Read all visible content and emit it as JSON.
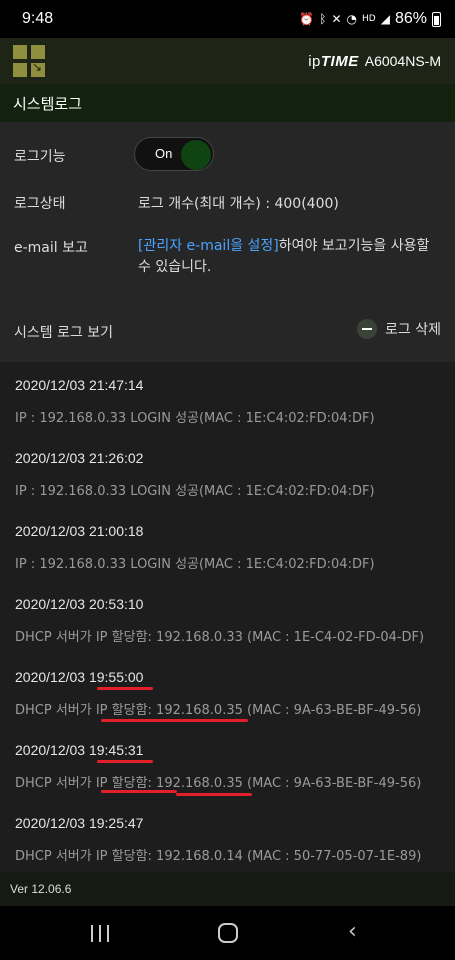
{
  "statusbar": {
    "time": "9:48",
    "battery": "86%"
  },
  "header": {
    "brand_prefix": "ip",
    "brand_name": "TIME",
    "model": "A6004NS-M"
  },
  "page": {
    "title": "시스템로그"
  },
  "settings": {
    "log_function_label": "로그기능",
    "toggle_label": "On",
    "toggle_on": true,
    "log_status_label": "로그상태",
    "log_status_value": "로그 개수(최대 개수) :  400(400)",
    "email_label": "e-mail 보고",
    "email_link": "[관리자 e-mail을 설정]",
    "email_text_after": "하여야 보고기능을 사용할 수 있습니다."
  },
  "log_section": {
    "title": "시스템 로그 보기",
    "delete_label": "로그 삭제"
  },
  "logs": [
    {
      "datetime": "2020/12/03 21:47:14",
      "message": "IP : 192.168.0.33 LOGIN 성공(MAC : 1E:C4:02:FD:04:DF)"
    },
    {
      "datetime": "2020/12/03 21:26:02",
      "message": "IP : 192.168.0.33 LOGIN 성공(MAC : 1E:C4:02:FD:04:DF)"
    },
    {
      "datetime": "2020/12/03 21:00:18",
      "message": "IP : 192.168.0.33 LOGIN 성공(MAC : 1E:C4:02:FD:04:DF)"
    },
    {
      "datetime": "2020/12/03 20:53:10",
      "message": "DHCP 서버가 IP 할당함: 192.168.0.33 (MAC : 1E-C4-02-FD-04-DF)"
    },
    {
      "datetime": "2020/12/03 19:55:00",
      "message": "DHCP 서버가 IP 할당함: 192.168.0.35 (MAC : 9A-63-BE-BF-49-56)"
    },
    {
      "datetime": "2020/12/03 19:45:31",
      "message": "DHCP 서버가 IP 할당함: 192.168.0.35 (MAC : 9A-63-BE-BF-49-56)"
    },
    {
      "datetime": "2020/12/03 19:25:47",
      "message": "DHCP 서버가 IP 할당함: 192.168.0.14 (MAC : 50-77-05-07-1E-89)"
    }
  ],
  "footer": {
    "version": "Ver 12.06.6"
  },
  "colors": {
    "accent_link": "#4aa3ff",
    "annotation_red": "#e3202a",
    "header_bg": "#1e2416",
    "title_bg": "#12220e"
  }
}
